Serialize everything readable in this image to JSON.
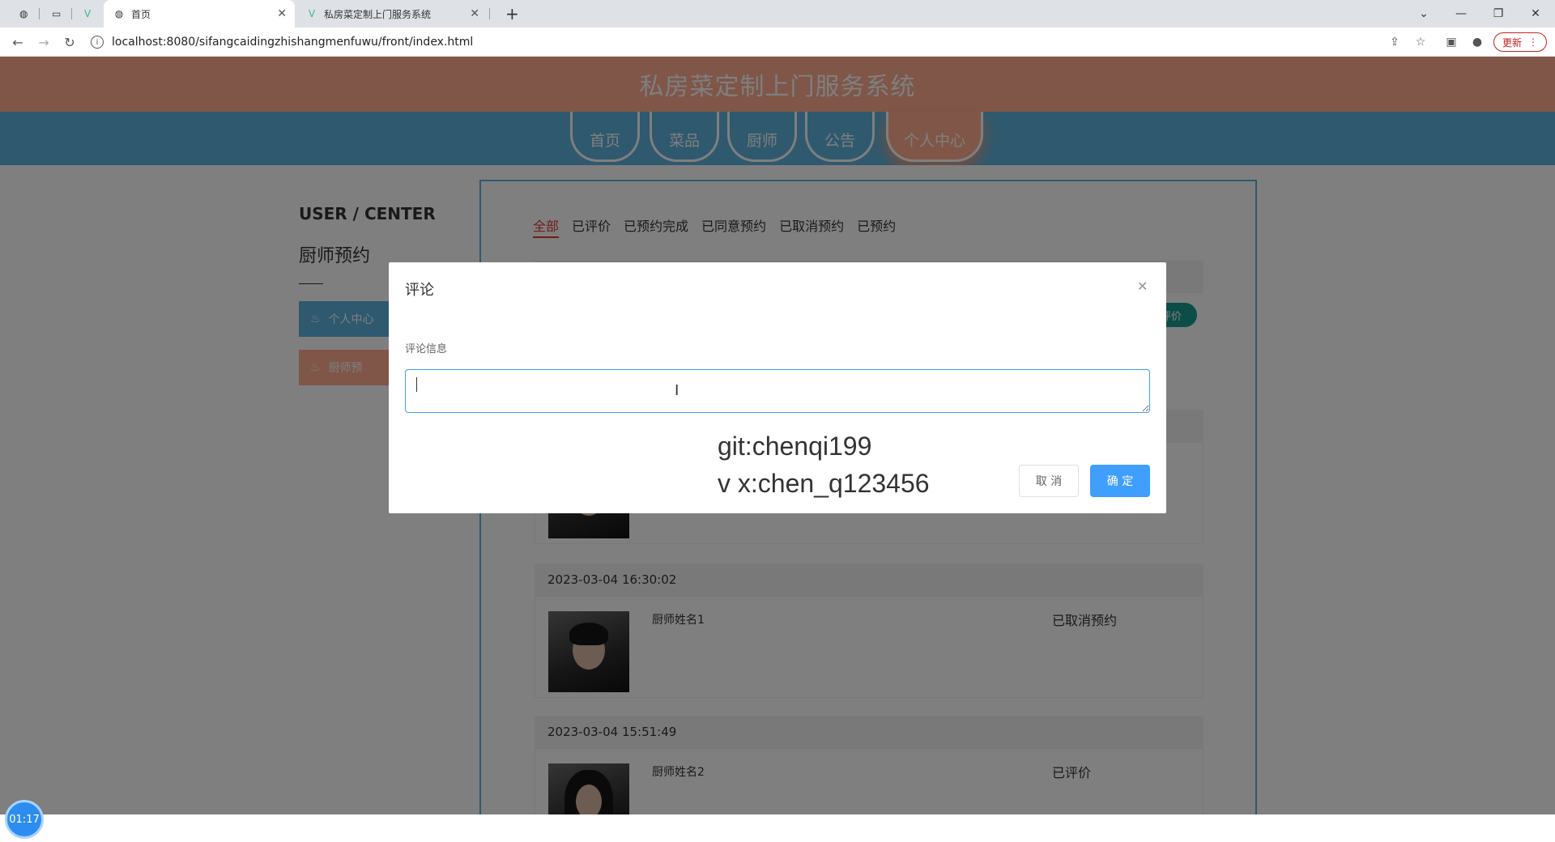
{
  "browser": {
    "tabs": [
      {
        "label": "",
        "icon": "globe-icon"
      },
      {
        "label": "",
        "icon": "blank-page-icon"
      },
      {
        "label": "",
        "icon": "vue-logo-icon"
      },
      {
        "label": "首页",
        "icon": "globe-icon",
        "active": true
      },
      {
        "label": "私房菜定制上门服务系统",
        "icon": "vue-logo-icon"
      }
    ],
    "url": "localhost:8080/sifangcaidingzhishangmenfuwu/front/index.html",
    "update_label": "更新"
  },
  "site": {
    "title": "私房菜定制上门服务系统",
    "nav": [
      "首页",
      "菜品",
      "厨师",
      "公告",
      "个人中心"
    ]
  },
  "sidebar": {
    "heading": "USER / CENTER",
    "subheading": "厨师预约",
    "items": [
      "个人中心",
      "厨师预"
    ]
  },
  "orders": {
    "filters": [
      "全部",
      "已评价",
      "已预约完成",
      "已同意预约",
      "已取消预约",
      "已预约"
    ],
    "pill_label": "评价",
    "list": [
      {
        "time": "2023-03-04 16:30:02",
        "chef": "厨师姓名1",
        "status": "已取消预约"
      },
      {
        "time": "2023-03-04 15:51:49",
        "chef": "厨师姓名2",
        "status": "已评价"
      }
    ]
  },
  "dialog": {
    "title": "评论",
    "field_label": "评论信息",
    "textarea_value": "",
    "cancel_label": "取 消",
    "confirm_label": "确 定",
    "watermark_line1": "git:chenqi199",
    "watermark_line2": "v x:chen_q123456"
  },
  "timer": "01:17",
  "colors": {
    "header": "#ffad91",
    "nav": "#5fb3dc",
    "primary_button": "#409eff",
    "active_filter": "#e53935",
    "pill": "#1a9b8f"
  }
}
